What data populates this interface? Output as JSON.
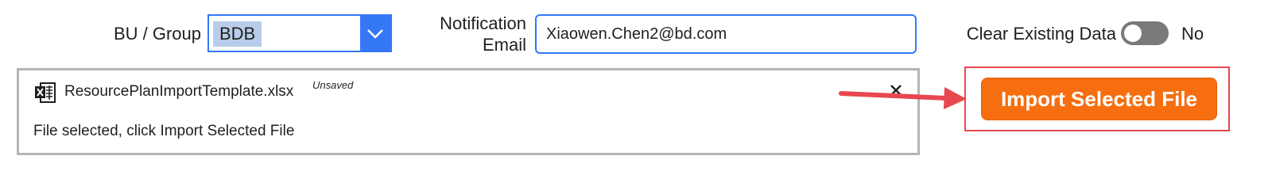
{
  "bu_group": {
    "label": "BU / Group",
    "selected_value": "BDB"
  },
  "notification": {
    "label_line1": "Notification",
    "label_line2": "Email",
    "email_value": "Xiaowen.Chen2@bd.com"
  },
  "clear_existing": {
    "label": "Clear Existing Data",
    "toggle_on": false,
    "state_text": "No"
  },
  "attachment": {
    "file_name": "ResourcePlanImportTemplate.xlsx",
    "badge": "Unsaved",
    "status_message": "File selected, click Import Selected File"
  },
  "import_button": {
    "label": "Import Selected File"
  },
  "colors": {
    "accent_blue": "#3478f6",
    "import_orange": "#f66e0f",
    "annotation_red": "#e8474f",
    "toggle_off": "#7a7a7a"
  },
  "icons": {
    "file": "excel-file-icon",
    "dropdown": "chevron-down-icon",
    "remove": "close-icon"
  }
}
